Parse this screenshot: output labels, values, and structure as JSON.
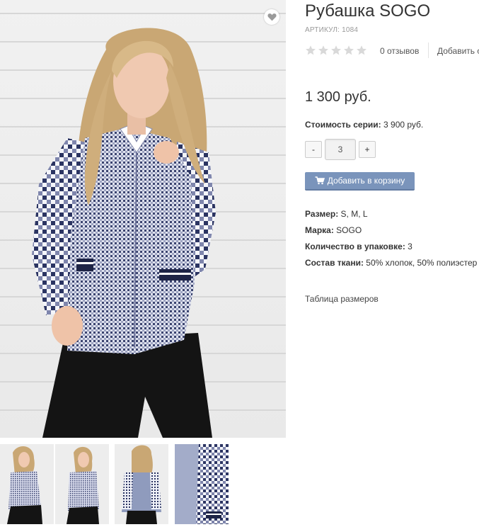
{
  "product": {
    "title": "Рубашка SOGO",
    "sku": "АРТИКУЛ: 1084",
    "rating": 0,
    "rating_max": 5,
    "reviews": "0 отзывов",
    "add_review": "Добавить о",
    "price": "1 300 руб.",
    "series_label": "Стоимость серии:",
    "series_value": " 3 900 руб.",
    "quantity": "3",
    "qty_minus": "-",
    "qty_plus": "+",
    "add_to_cart": "Добавить в корзину",
    "specs": [
      {
        "label": "Размер:",
        "value": " S, M, L"
      },
      {
        "label": "Марка:",
        "value": " SOGO"
      },
      {
        "label": "Количество в упаковке:",
        "value": " 3"
      },
      {
        "label": "Состав ткани:",
        "value": " 50% хлопок, 50% полиэстер"
      }
    ],
    "size_table": "Таблица размеров"
  },
  "colors": {
    "cart_button": "#7a94bb",
    "star_empty": "#d9d9d9",
    "shirt_check": "#3b4470",
    "pants": "#141414",
    "hair": "#c9a774"
  },
  "icons": {
    "favorite": "heart-icon",
    "cart": "cart-icon",
    "rating": "star-icon"
  }
}
